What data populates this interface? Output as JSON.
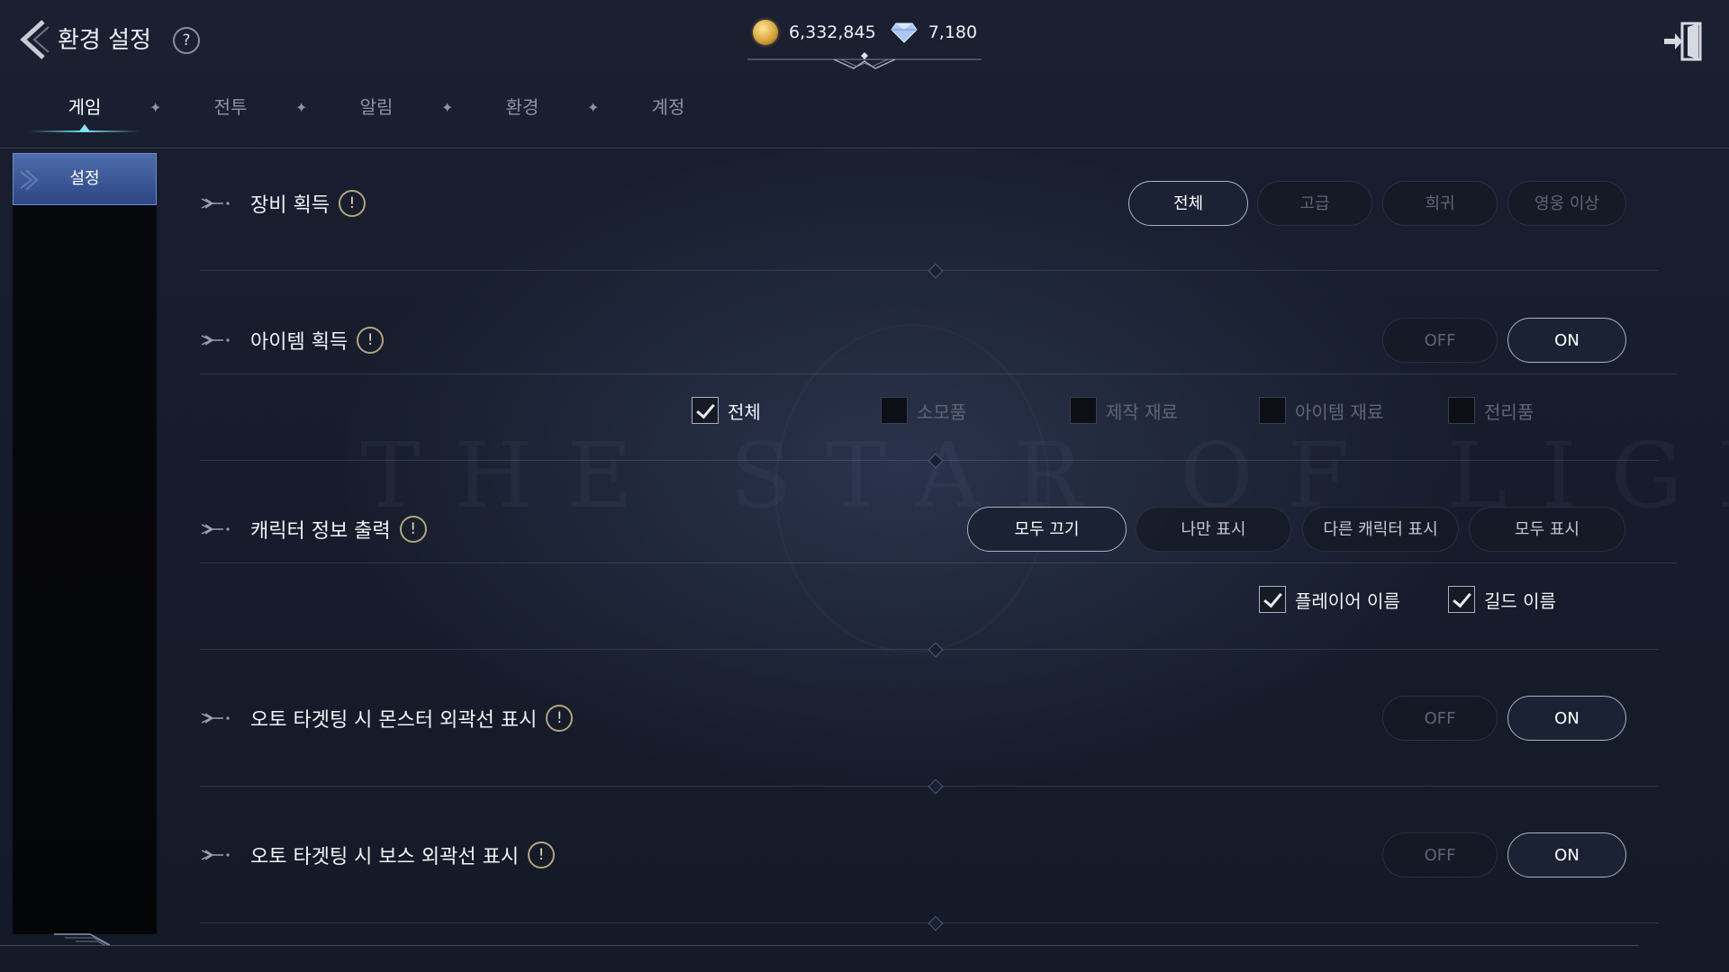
{
  "header": {
    "title": "환경 설정",
    "help": "?",
    "gold": "6,332,845",
    "gems": "7,180"
  },
  "tabs": [
    {
      "label": "게임",
      "active": true
    },
    {
      "label": "전투",
      "active": false
    },
    {
      "label": "알림",
      "active": false
    },
    {
      "label": "환경",
      "active": false
    },
    {
      "label": "계정",
      "active": false
    }
  ],
  "sidebar": {
    "items": [
      {
        "label": "설정",
        "active": true
      }
    ]
  },
  "settings": {
    "equipment": {
      "title": "장비 획득",
      "info": "!",
      "options": [
        "전체",
        "고급",
        "희귀",
        "영웅 이상"
      ],
      "selected": "전체"
    },
    "item": {
      "title": "아이템 획득",
      "info": "!",
      "off": "OFF",
      "on": "ON",
      "value": "ON",
      "filters": [
        {
          "label": "전체",
          "checked": true
        },
        {
          "label": "소모품",
          "checked": false
        },
        {
          "label": "제작 재료",
          "checked": false
        },
        {
          "label": "아이템 재료",
          "checked": false
        },
        {
          "label": "전리품",
          "checked": false
        }
      ]
    },
    "charinfo": {
      "title": "캐릭터 정보 출력",
      "info": "!",
      "options": [
        "모두 끄기",
        "나만 표시",
        "다른 캐릭터 표시",
        "모두 표시"
      ],
      "selected": "모두 끄기",
      "checks": [
        {
          "label": "플레이어 이름",
          "checked": true
        },
        {
          "label": "길드 이름",
          "checked": true
        }
      ]
    },
    "monster_outline": {
      "title": "오토 타겟팅 시 몬스터 외곽선 표시",
      "info": "!",
      "off": "OFF",
      "on": "ON",
      "value": "ON"
    },
    "boss_outline": {
      "title": "오토 타겟팅 시 보스 외곽선 표시",
      "info": "!",
      "off": "OFF",
      "on": "ON",
      "value": "ON"
    }
  },
  "colors": {
    "background": "#171d2d",
    "accent": "#6fe4ef",
    "sidebar_active": "#3d5a9a",
    "selected_border": "#a9b1c2"
  },
  "icons": {
    "back": "chevron-left-icon",
    "exit": "exit-door-icon",
    "gold": "gold-coin-icon",
    "gem": "diamond-gem-icon",
    "row_marker": "ornament-key-icon"
  }
}
